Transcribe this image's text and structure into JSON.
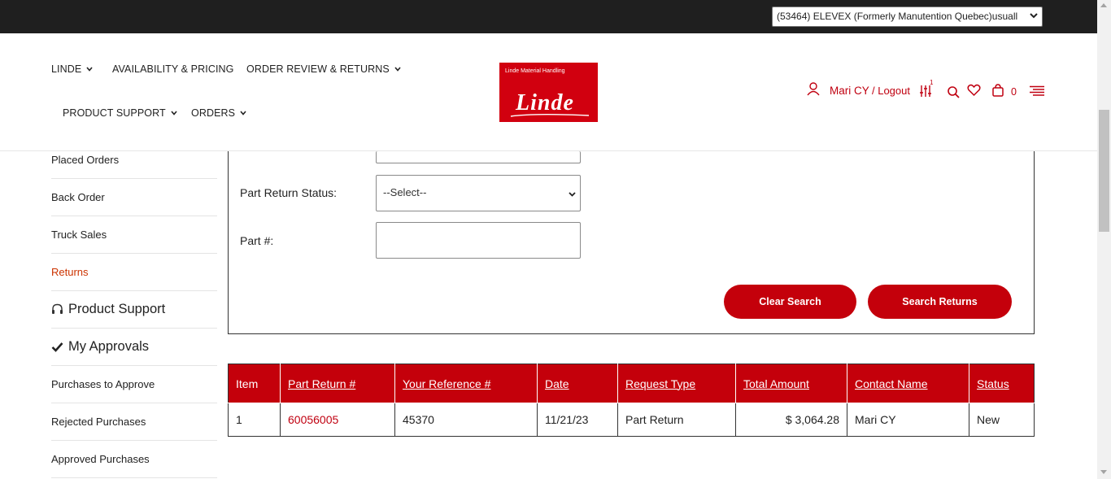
{
  "topbar": {
    "account_select_value": "(53464) ELEVEX (Formerly Manutention Quebec)usuall"
  },
  "nav": {
    "linde": "LINDE",
    "availability": "AVAILABILITY & PRICING",
    "order_review": "ORDER REVIEW & RETURNS",
    "product_support": "PRODUCT SUPPORT",
    "orders": "ORDERS"
  },
  "logo": {
    "small_text": "Linde Material Handling",
    "brand_text": "Linde",
    "brand_color": "#d1000f"
  },
  "user": {
    "name": "Mari CY",
    "logout": "/ Logout",
    "compare_badge": "1",
    "cart_count": "0"
  },
  "sidebar": {
    "items": [
      {
        "label": "Placed Orders"
      },
      {
        "label": "Back Order"
      },
      {
        "label": "Truck Sales"
      },
      {
        "label": "Returns"
      }
    ],
    "product_support": "Product Support",
    "my_approvals": "My Approvals",
    "approval_items": [
      {
        "label": "Purchases to Approve"
      },
      {
        "label": "Rejected Purchases"
      },
      {
        "label": "Approved Purchases"
      }
    ]
  },
  "search": {
    "status_label": "Part Return Status:",
    "status_value": "--Select--",
    "part_label": "Part #:",
    "part_value": "",
    "clear_button": "Clear Search",
    "search_button": "Search Returns"
  },
  "table": {
    "headers": [
      "Item",
      "Part Return #",
      "Your Reference #",
      "Date",
      "Request Type",
      "Total Amount",
      "Contact Name",
      "Status"
    ],
    "rows": [
      [
        "1",
        "60056005",
        "45370",
        "11/21/23",
        "Part Return",
        "$ 3,064.28",
        "Mari CY",
        "New"
      ]
    ]
  },
  "colors": {
    "accent_red": "#c4000b",
    "active_link": "#cc3300",
    "topbar": "#1f1f1f"
  }
}
